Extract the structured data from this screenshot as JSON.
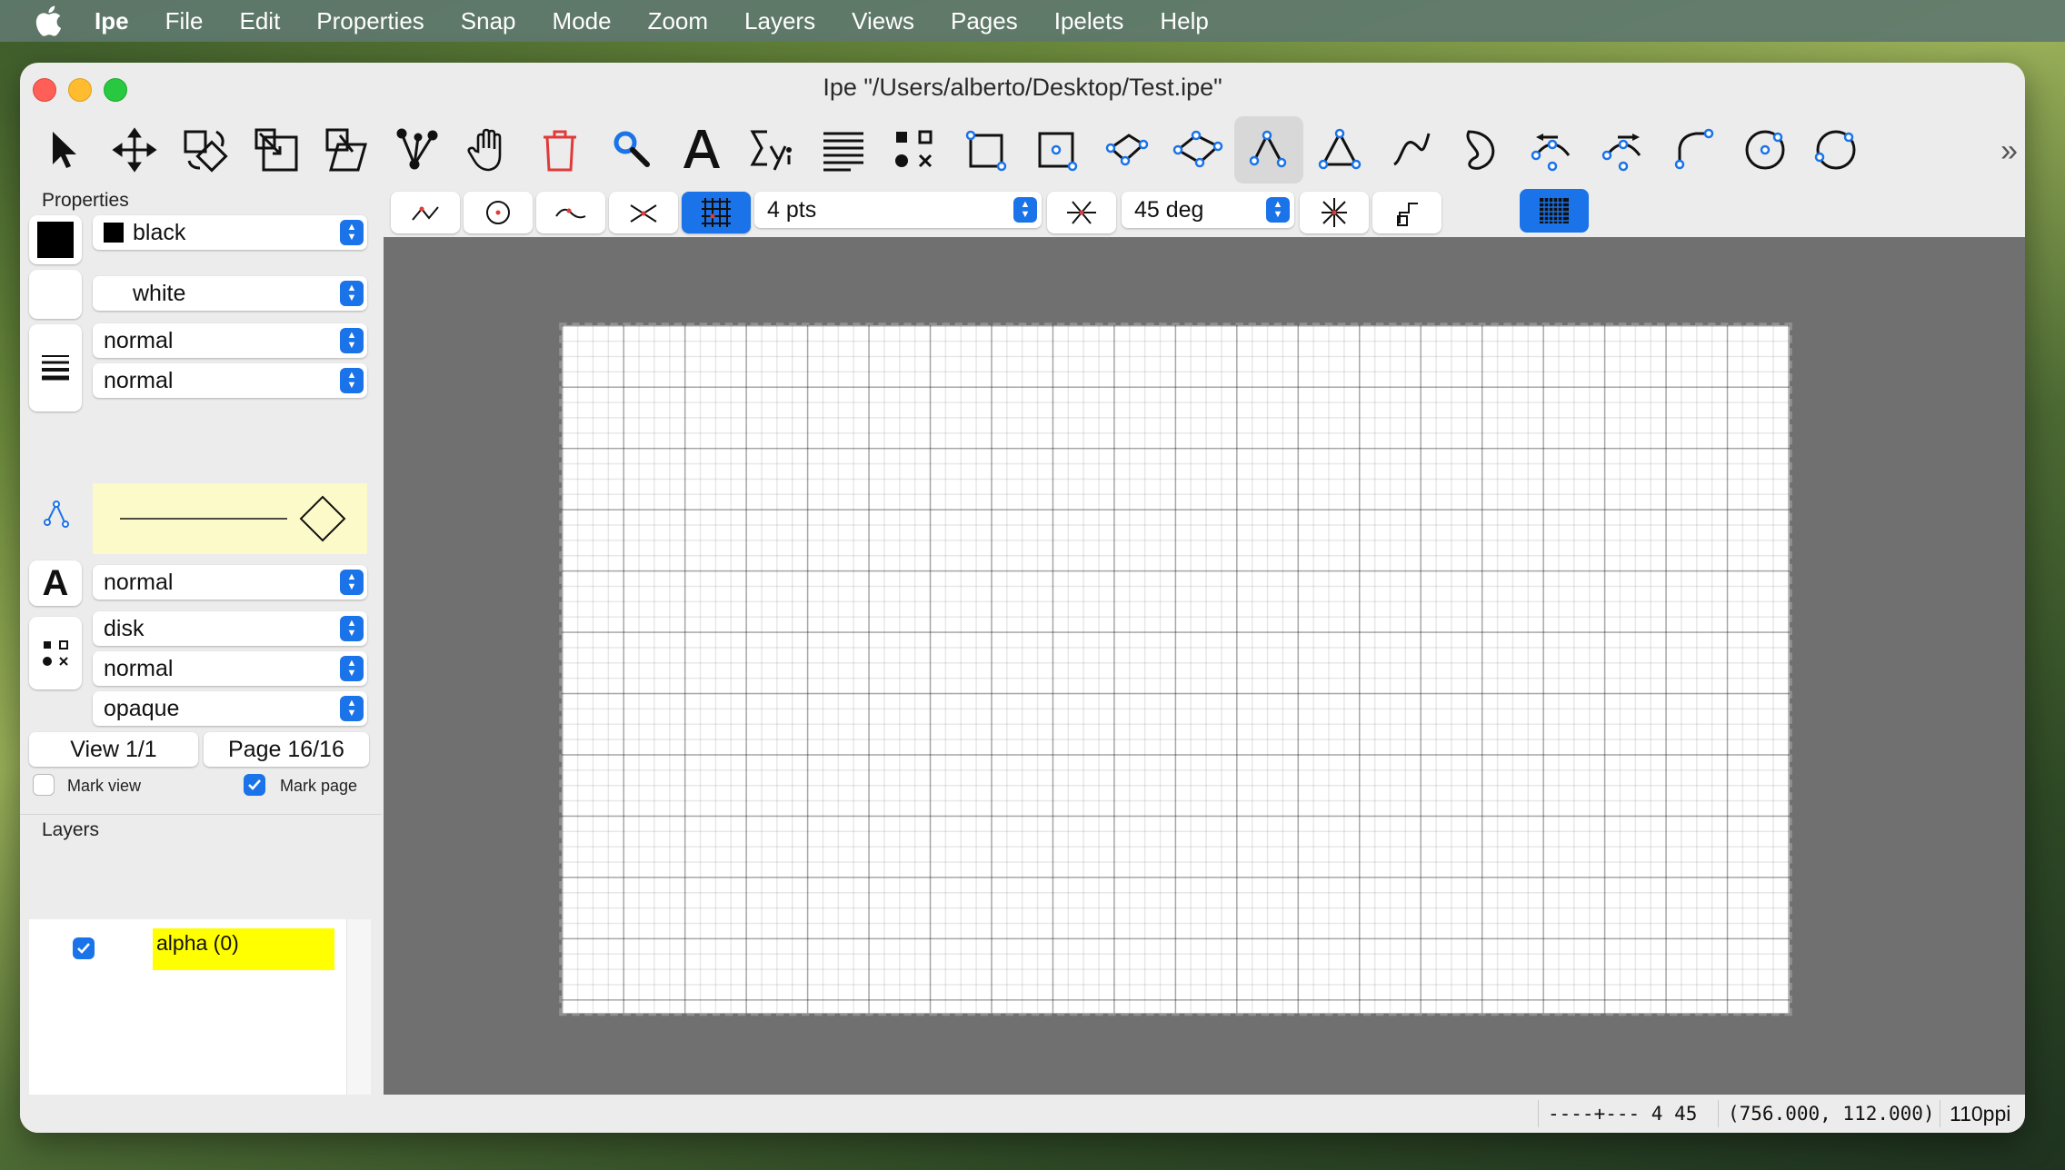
{
  "menubar": {
    "items": [
      "Ipe",
      "File",
      "Edit",
      "Properties",
      "Snap",
      "Mode",
      "Zoom",
      "Layers",
      "Views",
      "Pages",
      "Ipelets",
      "Help"
    ]
  },
  "window": {
    "title": "Ipe \"/Users/alberto/Desktop/Test.ipe\""
  },
  "toolbar": {
    "tools": [
      "select-arrow-icon",
      "move-icon",
      "rotate-icon",
      "stretch-icon",
      "shear-icon",
      "graph-icon",
      "pan-hand-icon",
      "delete-icon",
      "magnifier-icon",
      "text-icon",
      "math-text-icon",
      "paragraph-icon",
      "marks-icon",
      "rectangle-icon",
      "box-with-dot-icon",
      "parallelogram-icon",
      "polygon-icon",
      "polyline-icon",
      "triangle-icon",
      "spline-icon",
      "closed-spline-icon",
      "arc-left-icon",
      "arc-right-icon",
      "arc-icon",
      "circle-center-icon",
      "circle-3pt-icon"
    ],
    "active_tool": "polyline-icon"
  },
  "properties": {
    "title": "Properties",
    "stroke_color": "black",
    "fill_color": "white",
    "pen_width": "normal",
    "dash_style": "normal",
    "text_size": "normal",
    "mark_shape": "disk",
    "mark_size": "normal",
    "opacity": "opaque",
    "view_label": "View 1/1",
    "page_label": "Page 16/16",
    "mark_view_label": "Mark view",
    "mark_view_checked": false,
    "mark_page_label": "Mark page",
    "mark_page_checked": true
  },
  "layers": {
    "title": "Layers",
    "items": [
      {
        "name": "alpha (0)",
        "visible": true
      }
    ]
  },
  "snapbar": {
    "grid_size": "4 pts",
    "angle": "45 deg",
    "grid_snap_on": true
  },
  "statusbar": {
    "ruler": "----+--- 4 45",
    "coords": "(756.000, 112.000)",
    "resolution": "110ppi"
  },
  "colors": {
    "accent": "#1a73e8",
    "layer_highlight": "#ffff00",
    "arrow_preview_bg": "#fdfac9",
    "canvas_bg": "#707070"
  }
}
